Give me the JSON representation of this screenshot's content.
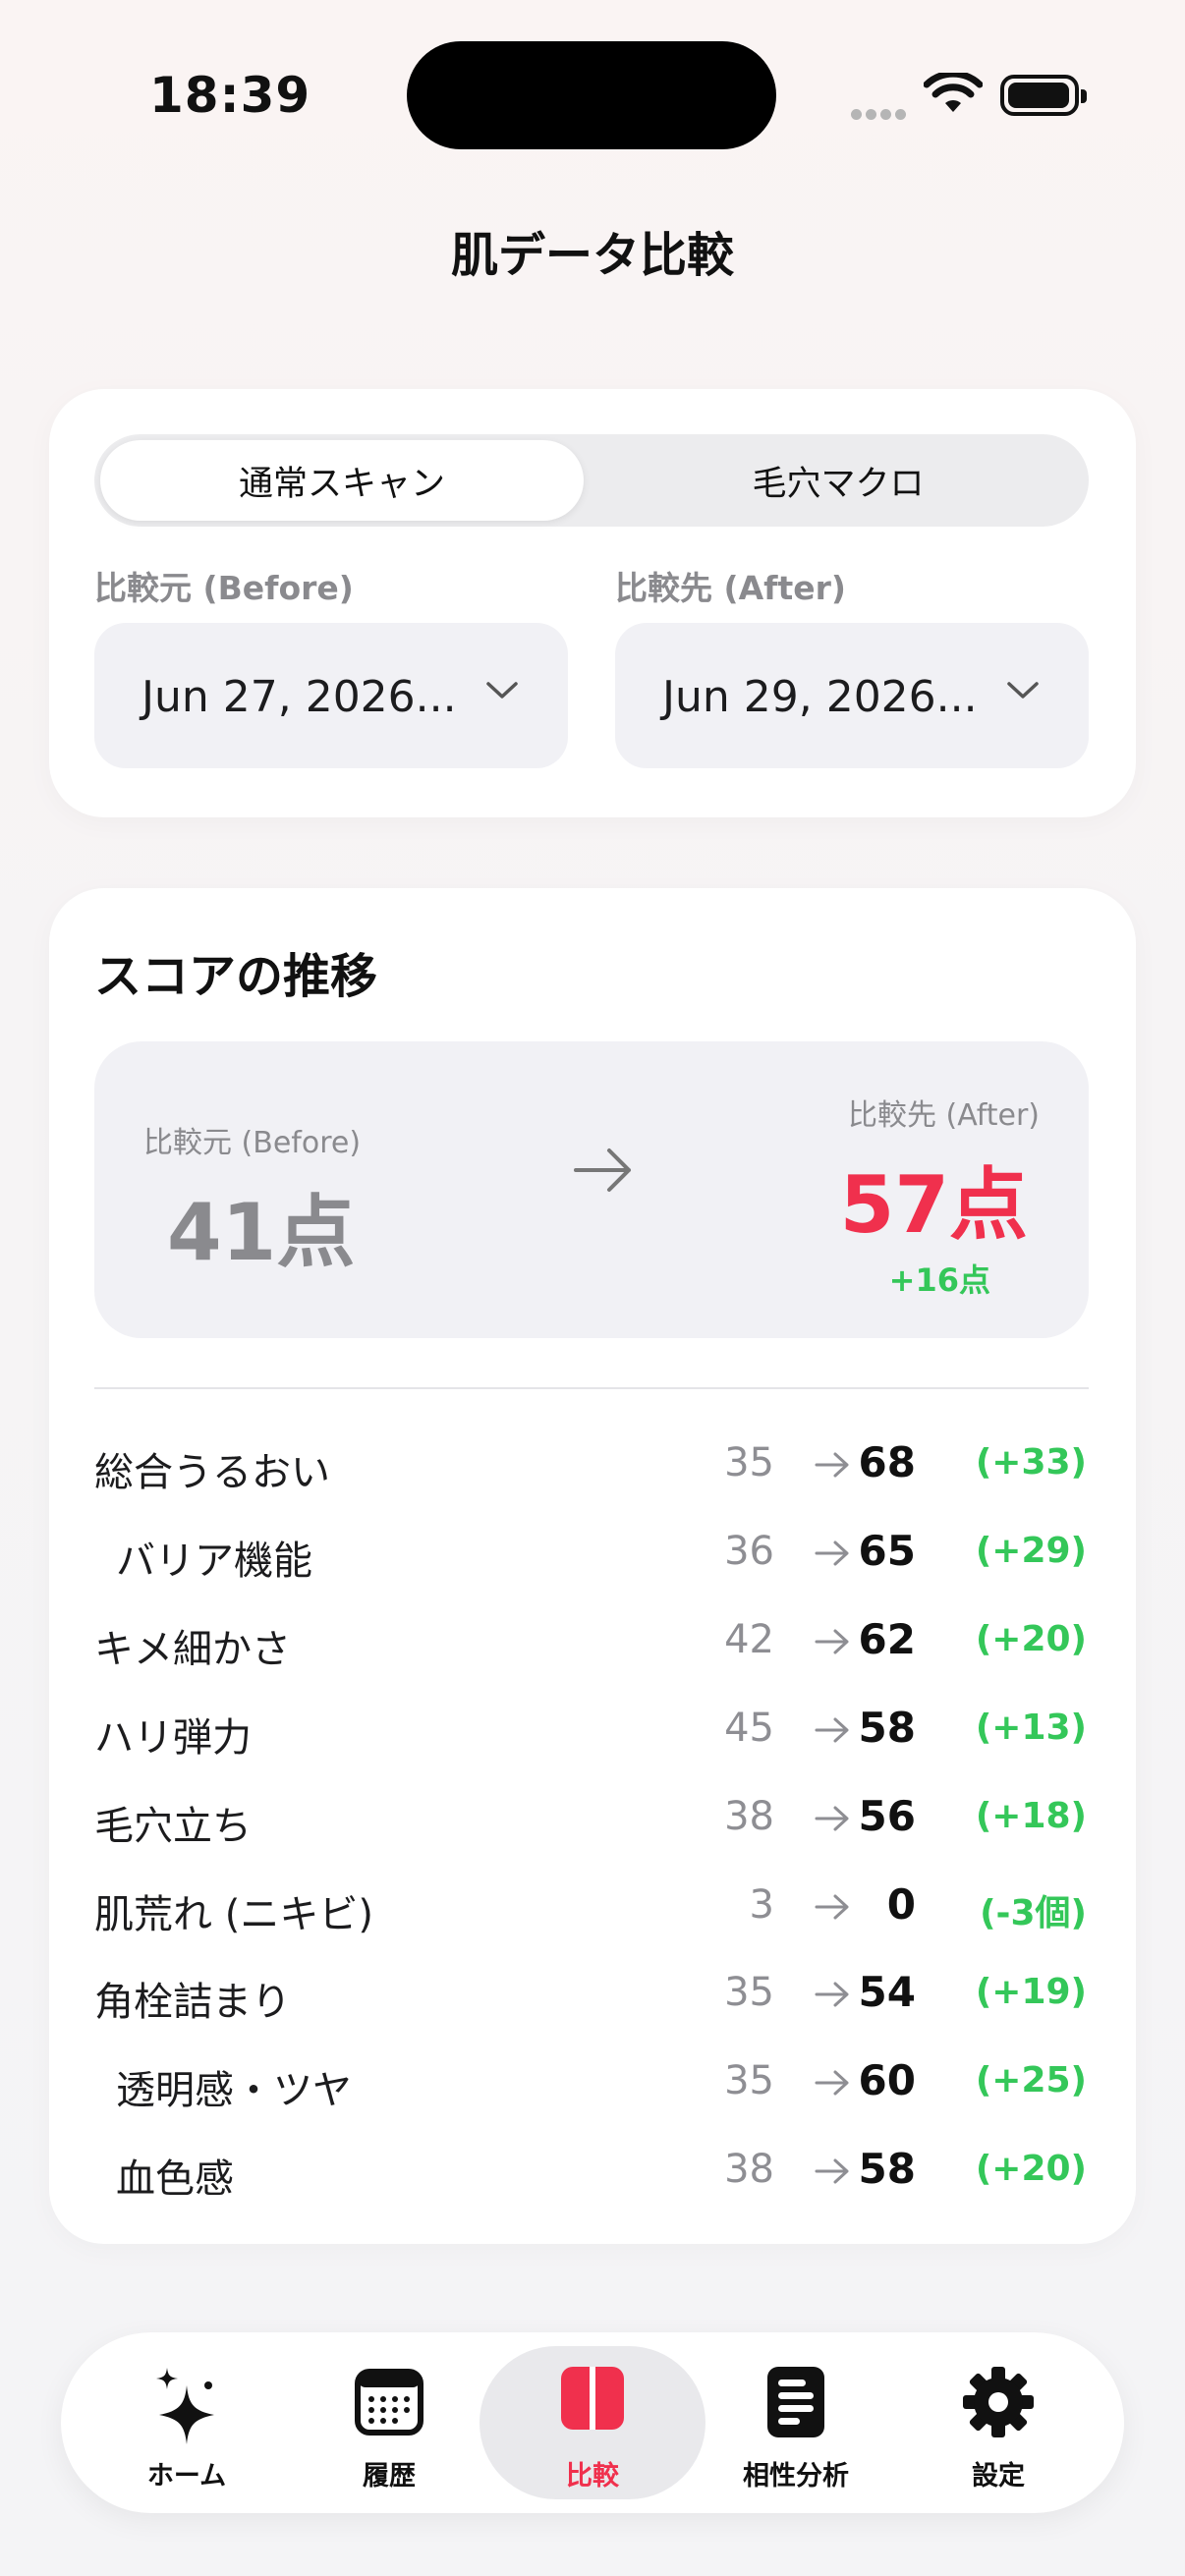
{
  "status_bar": {
    "time": "18:39"
  },
  "page": {
    "title": "肌データ比較"
  },
  "scan_type": {
    "options": [
      "通常スキャン",
      "毛穴マクロ"
    ],
    "selected": "通常スキャン"
  },
  "before": {
    "label": "比較元 (Before)",
    "date": "Jun 27, 2026..."
  },
  "after": {
    "label": "比較先 (After)",
    "date": "Jun 29, 2026..."
  },
  "score": {
    "section_title": "スコアの推移",
    "before_label": "比較元 (Before)",
    "before_value": "41点",
    "after_label": "比較先 (After)",
    "after_value": "57点",
    "diff": "+16点"
  },
  "metrics": [
    {
      "label": "総合うるおい",
      "before": "35",
      "after": "68",
      "diff": "(+33)",
      "indent": false
    },
    {
      "label": "バリア機能",
      "before": "36",
      "after": "65",
      "diff": "(+29)",
      "indent": true
    },
    {
      "label": "キメ細かさ",
      "before": "42",
      "after": "62",
      "diff": "(+20)",
      "indent": false
    },
    {
      "label": "ハリ弾力",
      "before": "45",
      "after": "58",
      "diff": "(+13)",
      "indent": false
    },
    {
      "label": "毛穴立ち",
      "before": "38",
      "after": "56",
      "diff": "(+18)",
      "indent": false
    },
    {
      "label": "肌荒れ (ニキビ)",
      "before": "3",
      "after": "0",
      "diff": "(-3個)",
      "indent": false
    },
    {
      "label": "角栓詰まり",
      "before": "35",
      "after": "54",
      "diff": "(+19)",
      "indent": false
    },
    {
      "label": "透明感・ツヤ",
      "before": "35",
      "after": "60",
      "diff": "(+25)",
      "indent": true
    },
    {
      "label": "血色感",
      "before": "38",
      "after": "58",
      "diff": "(+20)",
      "indent": true
    }
  ],
  "tab_bar": {
    "items": [
      {
        "label": "ホーム",
        "icon": "sparkles-icon"
      },
      {
        "label": "履歴",
        "icon": "calendar-icon"
      },
      {
        "label": "比較",
        "icon": "compare-icon"
      },
      {
        "label": "相性分析",
        "icon": "document-icon"
      },
      {
        "label": "設定",
        "icon": "gear-icon"
      }
    ],
    "active": "比較"
  },
  "colors": {
    "accent": "#f0304d",
    "positive": "#34c759",
    "muted": "#8a8a8e"
  }
}
